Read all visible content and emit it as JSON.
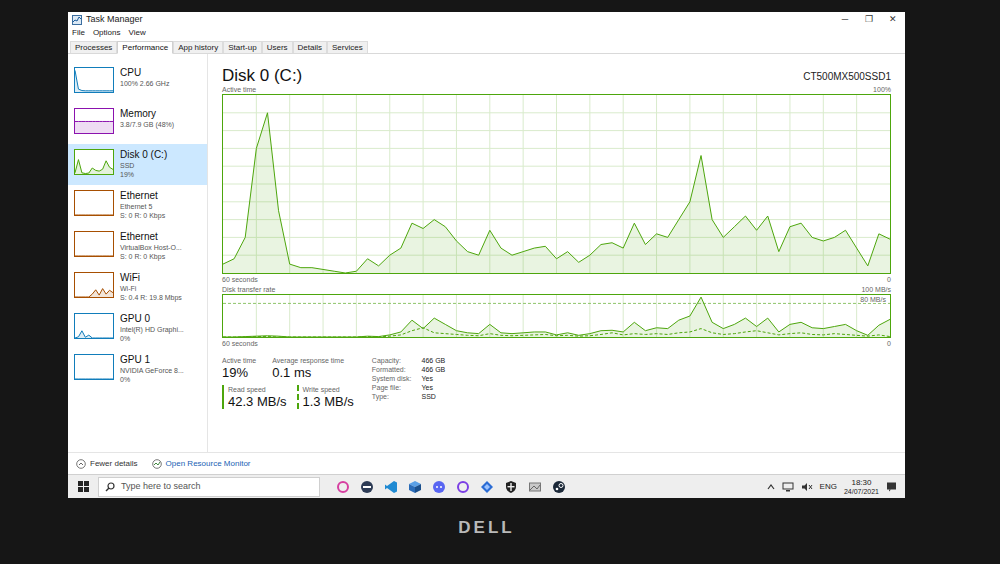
{
  "window": {
    "title": "Task Manager",
    "controls": [
      "─",
      "❐",
      "✕"
    ]
  },
  "menu": [
    "File",
    "Options",
    "View"
  ],
  "tabs": [
    {
      "label": "Processes",
      "selected": false
    },
    {
      "label": "Performance",
      "selected": true
    },
    {
      "label": "App history",
      "selected": false
    },
    {
      "label": "Start-up",
      "selected": false
    },
    {
      "label": "Users",
      "selected": false
    },
    {
      "label": "Details",
      "selected": false
    },
    {
      "label": "Services",
      "selected": false
    }
  ],
  "sidebar": {
    "items": [
      {
        "title": "CPU",
        "lines": [
          "100% 2.66 GHz"
        ],
        "selected": false,
        "color": "#117dbb",
        "graph": [
          90,
          12,
          6,
          5,
          5,
          5,
          5,
          5,
          5,
          5,
          5,
          5
        ]
      },
      {
        "title": "Memory",
        "lines": [
          "3.8/7.9 GB (48%)"
        ],
        "selected": false,
        "color": "#8b12ae",
        "graph": [
          48,
          48,
          48,
          48,
          48,
          48,
          48,
          48,
          48,
          48,
          48,
          48
        ]
      },
      {
        "title": "Disk 0 (C:)",
        "lines": [
          "SSD",
          "19%"
        ],
        "selected": true,
        "color": "#4da60c",
        "graph": [
          5,
          60,
          5,
          2,
          4,
          25,
          15,
          12,
          20,
          55,
          28,
          19
        ]
      },
      {
        "title": "Ethernet",
        "lines": [
          "Ethernet 5",
          "S: 0 R: 0 Kbps"
        ],
        "selected": false,
        "color": "#a74f01",
        "graph": [
          0,
          0,
          0,
          0,
          0,
          0,
          0,
          0,
          0,
          0,
          0,
          0
        ]
      },
      {
        "title": "Ethernet",
        "lines": [
          "VirtualBox Host-O...",
          "S: 0 R: 0 Kbps"
        ],
        "selected": false,
        "color": "#a74f01",
        "graph": [
          0,
          0,
          0,
          0,
          0,
          0,
          0,
          0,
          0,
          0,
          0,
          0
        ]
      },
      {
        "title": "WiFi",
        "lines": [
          "Wi-Fi",
          "S: 0.4 R: 19.8 Mbps"
        ],
        "selected": false,
        "color": "#a74f01",
        "graph": [
          0,
          0,
          0,
          0,
          0,
          12,
          30,
          8,
          35,
          12,
          28,
          18
        ]
      },
      {
        "title": "GPU 0",
        "lines": [
          "Intel(R) HD Graphi...",
          "0%"
        ],
        "selected": false,
        "color": "#117dbb",
        "graph": [
          0,
          5,
          30,
          3,
          12,
          0,
          0,
          0,
          0,
          0,
          0,
          0
        ]
      },
      {
        "title": "GPU 1",
        "lines": [
          "NVIDIA GeForce 8...",
          "0%"
        ],
        "selected": false,
        "color": "#117dbb",
        "graph": [
          0,
          0,
          0,
          0,
          0,
          0,
          0,
          0,
          0,
          0,
          0,
          0
        ]
      }
    ]
  },
  "detail": {
    "title": "Disk 0 (C:)",
    "model": "CT500MX500SSD1",
    "active_chart": {
      "label": "Active time",
      "max": "100%",
      "x_label": "60 seconds",
      "min": "0",
      "axis_max": 100,
      "values": [
        5,
        8,
        20,
        70,
        90,
        35,
        5,
        3,
        3,
        2,
        1,
        0,
        1,
        8,
        4,
        10,
        14,
        28,
        25,
        30,
        26,
        18,
        12,
        10,
        24,
        14,
        10,
        12,
        14,
        15,
        8,
        12,
        6,
        10,
        16,
        17,
        14,
        28,
        16,
        22,
        20,
        30,
        40,
        66,
        30,
        20,
        26,
        32,
        24,
        32,
        12,
        26,
        28,
        20,
        18,
        20,
        24,
        14,
        4,
        22,
        19
      ]
    },
    "transfer_chart": {
      "label": "Disk transfer rate",
      "max": "100 MB/s",
      "marker": "80 MB/s",
      "marker_value": 80,
      "x_label": "60 seconds",
      "min": "0",
      "axis_max": 100,
      "read": [
        0,
        0,
        1,
        2,
        3,
        2,
        0,
        0,
        0,
        0,
        0,
        0,
        0,
        2,
        1,
        5,
        12,
        40,
        20,
        45,
        30,
        15,
        10,
        8,
        30,
        10,
        8,
        10,
        12,
        12,
        5,
        10,
        4,
        8,
        15,
        16,
        12,
        35,
        15,
        22,
        20,
        40,
        50,
        95,
        35,
        20,
        30,
        45,
        25,
        45,
        12,
        30,
        35,
        22,
        20,
        25,
        30,
        15,
        4,
        28,
        42
      ],
      "write": [
        0,
        0,
        0,
        1,
        1,
        0,
        0,
        0,
        0,
        0,
        0,
        0,
        0,
        1,
        0,
        2,
        5,
        15,
        22,
        10,
        8,
        6,
        4,
        3,
        8,
        4,
        3,
        4,
        5,
        6,
        3,
        4,
        2,
        3,
        6,
        10,
        5,
        8,
        6,
        8,
        6,
        10,
        12,
        20,
        10,
        6,
        8,
        12,
        15,
        10,
        5,
        8,
        10,
        6,
        5,
        8,
        6,
        4,
        2,
        5,
        1
      ]
    },
    "stats": [
      {
        "label": "Active time",
        "value": "19%"
      },
      {
        "label": "Average response time",
        "value": "0.1 ms"
      }
    ],
    "speeds": [
      {
        "label": "Read speed",
        "value": "42.3 MB/s",
        "kind": "solid"
      },
      {
        "label": "Write speed",
        "value": "1.3 MB/s",
        "kind": "dashed"
      }
    ],
    "properties": [
      {
        "label": "Capacity:",
        "value": "466 GB"
      },
      {
        "label": "Formatted:",
        "value": "466 GB"
      },
      {
        "label": "System disk:",
        "value": "Yes"
      },
      {
        "label": "Page file:",
        "value": "Yes"
      },
      {
        "label": "Type:",
        "value": "SSD"
      }
    ]
  },
  "footer": {
    "fewer_details": "Fewer details",
    "resource_monitor": "Open Resource Monitor"
  },
  "taskbar": {
    "search_placeholder": "Type here to search",
    "language": "ENG",
    "time": "18:30",
    "date": "24/07/2021"
  },
  "device": {
    "logo": "DELL"
  }
}
